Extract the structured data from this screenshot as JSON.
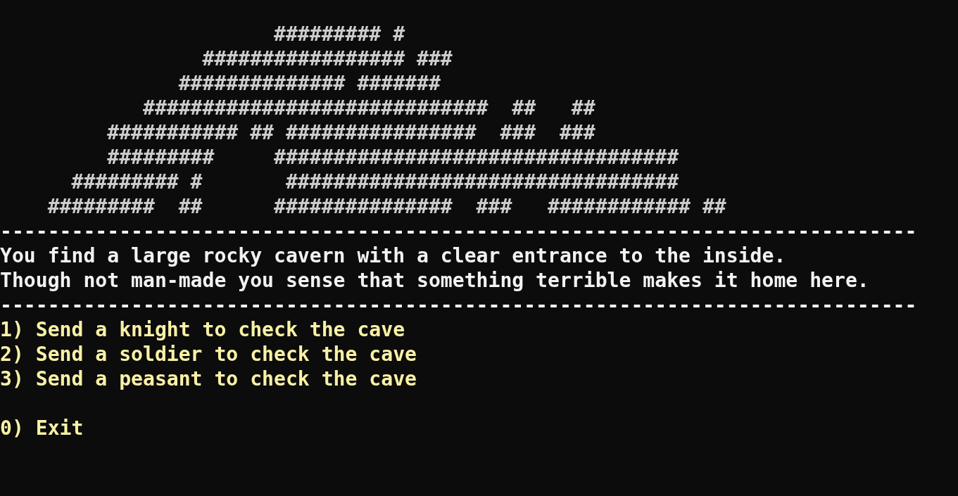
{
  "ascii_art": [
    "                       ######### #",
    "                 ################# ###",
    "               ############## #######",
    "            #############################  ##   ##",
    "         ########### ## ################  ###  ###",
    "         #########     ##################################",
    "      ######### #       #################################",
    "    #########  ##      ###############  ###   ############ ##"
  ],
  "separator_top": "-----------------------------------------------------------------------------",
  "description": [
    "You find a large rocky cavern with a clear entrance to the inside.",
    "Though not man-made you sense that something terrible makes it home here."
  ],
  "separator_bottom": "-----------------------------------------------------------------------------",
  "options": [
    "1) Send a knight to check the cave",
    "2) Send a soldier to check the cave",
    "3) Send a peasant to check the cave"
  ],
  "exit_option": "0) Exit"
}
